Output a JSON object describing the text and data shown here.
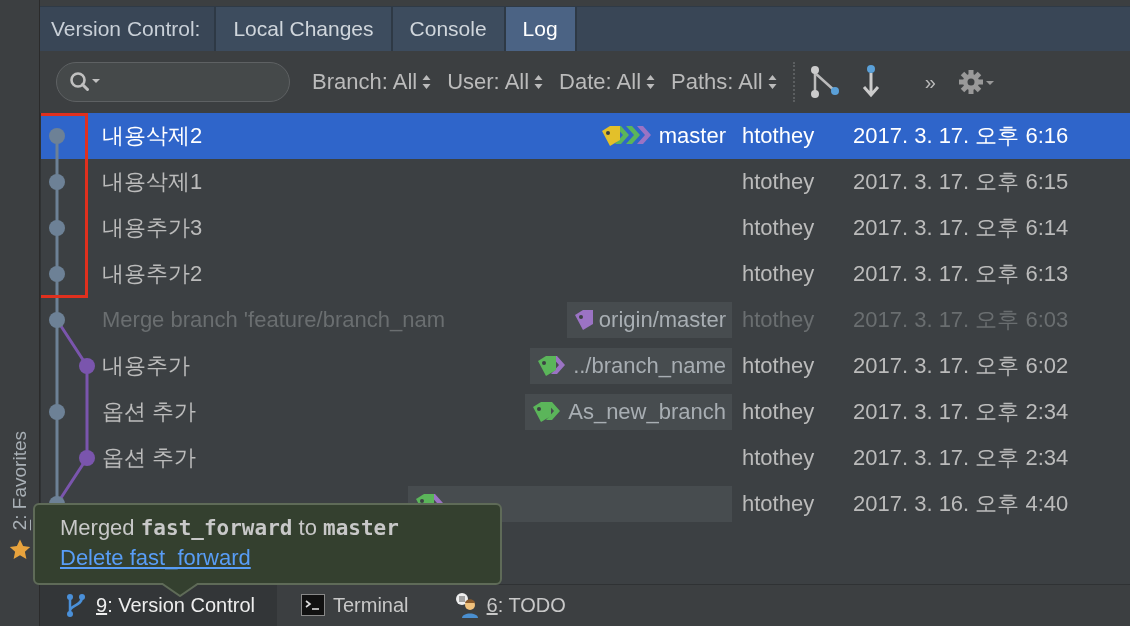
{
  "side_panel": {
    "favorites": {
      "mnemonic": "2",
      "label": ": Favorites"
    }
  },
  "tabs_label": "Version Control:",
  "tabs": [
    {
      "label": "Local Changes",
      "selected": false
    },
    {
      "label": "Console",
      "selected": false
    },
    {
      "label": "Log",
      "selected": true
    }
  ],
  "filters": [
    {
      "label": "Branch: All"
    },
    {
      "label": "User: All"
    },
    {
      "label": "Date: All"
    },
    {
      "label": "Paths: All"
    }
  ],
  "overflow": "»",
  "commits": [
    {
      "subject": "내용삭제2",
      "kind": "main",
      "color": "#6d8196",
      "selected": true,
      "dimmed": false,
      "refs": {
        "label": "master",
        "boxed": false,
        "tags": [
          {
            "color": "#e3c02a"
          },
          {
            "color": "#5bb55a"
          },
          {
            "color": "#5bb55a"
          },
          {
            "color": "#9b73c4"
          }
        ]
      },
      "author": "htothey",
      "date": "2017. 3. 17. 오후 6:16"
    },
    {
      "subject": "내용삭제1",
      "kind": "main",
      "color": "#6d8196",
      "selected": false,
      "dimmed": false,
      "author": "htothey",
      "date": "2017. 3. 17. 오후 6:15"
    },
    {
      "subject": "내용추가3",
      "kind": "main",
      "color": "#6d8196",
      "selected": false,
      "dimmed": false,
      "author": "htothey",
      "date": "2017. 3. 17. 오후 6:14"
    },
    {
      "subject": "내용추가2",
      "kind": "main",
      "color": "#6d8196",
      "selected": false,
      "dimmed": false,
      "author": "htothey",
      "date": "2017. 3. 17. 오후 6:13"
    },
    {
      "subject": "Merge branch 'feature/branch_nam",
      "kind": "main",
      "color": "#6d8196",
      "selected": false,
      "dimmed": true,
      "refs": {
        "label": "origin/master",
        "boxed": true,
        "tags": [
          {
            "color": "#9b73c4"
          }
        ]
      },
      "author": "htothey",
      "date": "2017. 3. 17. 오후 6:03"
    },
    {
      "subject": "내용추가",
      "kind": "side",
      "color": "#7a55ad",
      "selected": false,
      "dimmed": false,
      "refs": {
        "label": "../branch_name",
        "boxed": true,
        "tags": [
          {
            "color": "#5bb55a"
          },
          {
            "color": "#9b73c4"
          }
        ]
      },
      "author": "htothey",
      "date": "2017. 3. 17. 오후 6:02"
    },
    {
      "subject": "옵션 추가",
      "kind": "main",
      "color": "#6d8196",
      "selected": false,
      "dimmed": false,
      "refs": {
        "label": "As_new_branch",
        "boxed": true,
        "tags": [
          {
            "color": "#5bb55a"
          },
          {
            "color": "#5bb55a"
          }
        ]
      },
      "author": "htothey",
      "date": "2017. 3. 17. 오후 2:34"
    },
    {
      "subject": "옵션 추가",
      "kind": "side",
      "color": "#7a55ad",
      "selected": false,
      "dimmed": false,
      "author": "htothey",
      "date": "2017. 3. 17. 오후 2:34"
    },
    {
      "kind": "main",
      "color": "#6d8196",
      "selected": false,
      "dimmed": false,
      "refs": {
        "boxed": true,
        "tags": [
          {
            "color": "#5bb55a"
          },
          {
            "color": "#9b73c4"
          }
        ]
      },
      "author": "htothey",
      "date": "2017. 3. 16. 오후 4:40"
    }
  ],
  "notification": {
    "message": "Merged **fast_forward** to **master**",
    "link": "Delete fast_forward"
  },
  "bottom_tabs": [
    {
      "kind": "vcs",
      "mnemonic": "9",
      "label": ": Version Control",
      "selected": true
    },
    {
      "kind": "terminal",
      "label": "Terminal",
      "selected": false
    },
    {
      "kind": "todo",
      "mnemonic": "6",
      "label": ": TODO",
      "selected": false
    }
  ]
}
